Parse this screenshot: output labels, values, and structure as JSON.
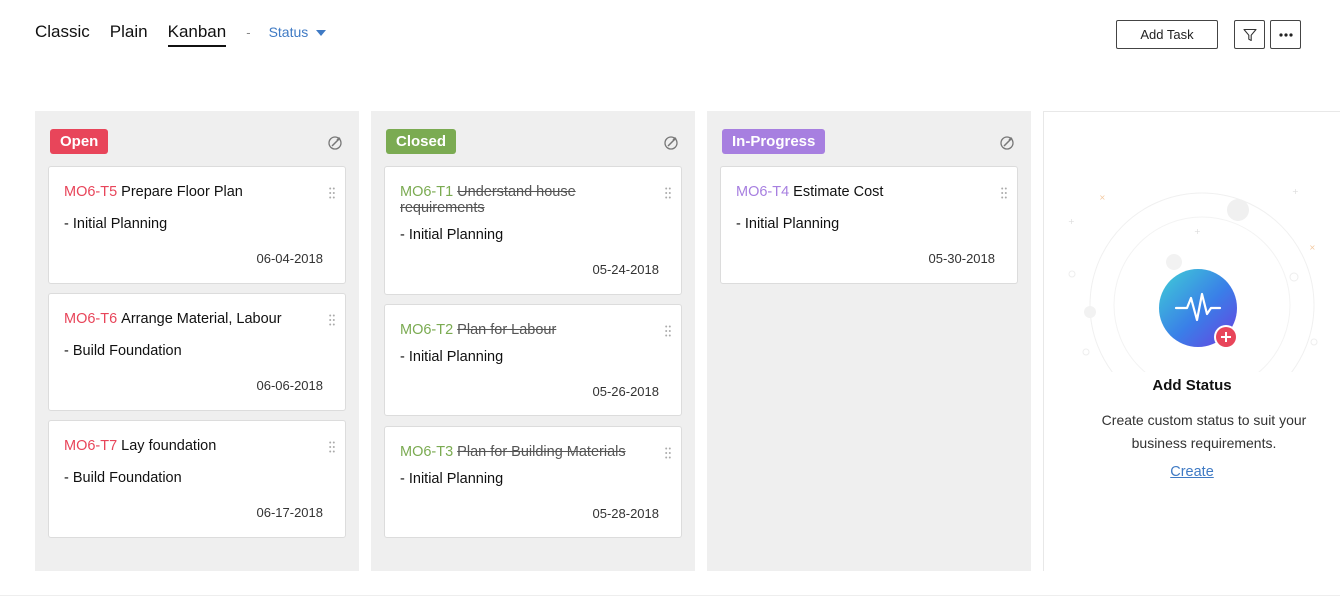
{
  "views": {
    "tabs": [
      {
        "label": "Classic"
      },
      {
        "label": "Plain"
      },
      {
        "label": "Kanban"
      }
    ],
    "active": "Kanban",
    "separator": "-",
    "group_by": "Status"
  },
  "toolbar": {
    "add_task_label": "Add Task",
    "icons": [
      "filter-icon",
      "more-icon"
    ]
  },
  "columns": [
    {
      "status": "Open",
      "color": "#e8455a",
      "id_color": "#e8455a",
      "tasks": [
        {
          "id": "MO6-T5",
          "name": "Prepare Floor Plan",
          "list": "- Initial Planning",
          "date": "06-04-2018",
          "completed": false
        },
        {
          "id": "MO6-T6",
          "name": "Arrange Material, Labour",
          "list": "- Build Foundation",
          "date": "06-06-2018",
          "completed": false
        },
        {
          "id": "MO6-T7",
          "name": "Lay foundation",
          "list": "- Build Foundation",
          "date": "06-17-2018",
          "completed": false
        }
      ]
    },
    {
      "status": "Closed",
      "color": "#7bab52",
      "id_color": "#7bab52",
      "tasks": [
        {
          "id": "MO6-T1",
          "name": "Understand house requirements",
          "list": "- Initial Planning",
          "date": "05-24-2018",
          "completed": true
        },
        {
          "id": "MO6-T2",
          "name": "Plan for Labour",
          "list": "- Initial Planning",
          "date": "05-26-2018",
          "completed": true
        },
        {
          "id": "MO6-T3",
          "name": "Plan for Building Materials",
          "list": "- Initial Planning",
          "date": "05-28-2018",
          "completed": true
        }
      ]
    },
    {
      "status": "In-Progress",
      "color": "#a77fe0",
      "id_color": "#a77fe0",
      "tasks": [
        {
          "id": "MO6-T4",
          "name": "Estimate Cost",
          "list": "- Initial Planning",
          "date": "05-30-2018",
          "completed": false
        }
      ]
    }
  ],
  "add_status": {
    "title": "Add Status",
    "description": "Create custom status to suit your business requirements.",
    "link": "Create",
    "icon": "pulse-plus-icon"
  }
}
